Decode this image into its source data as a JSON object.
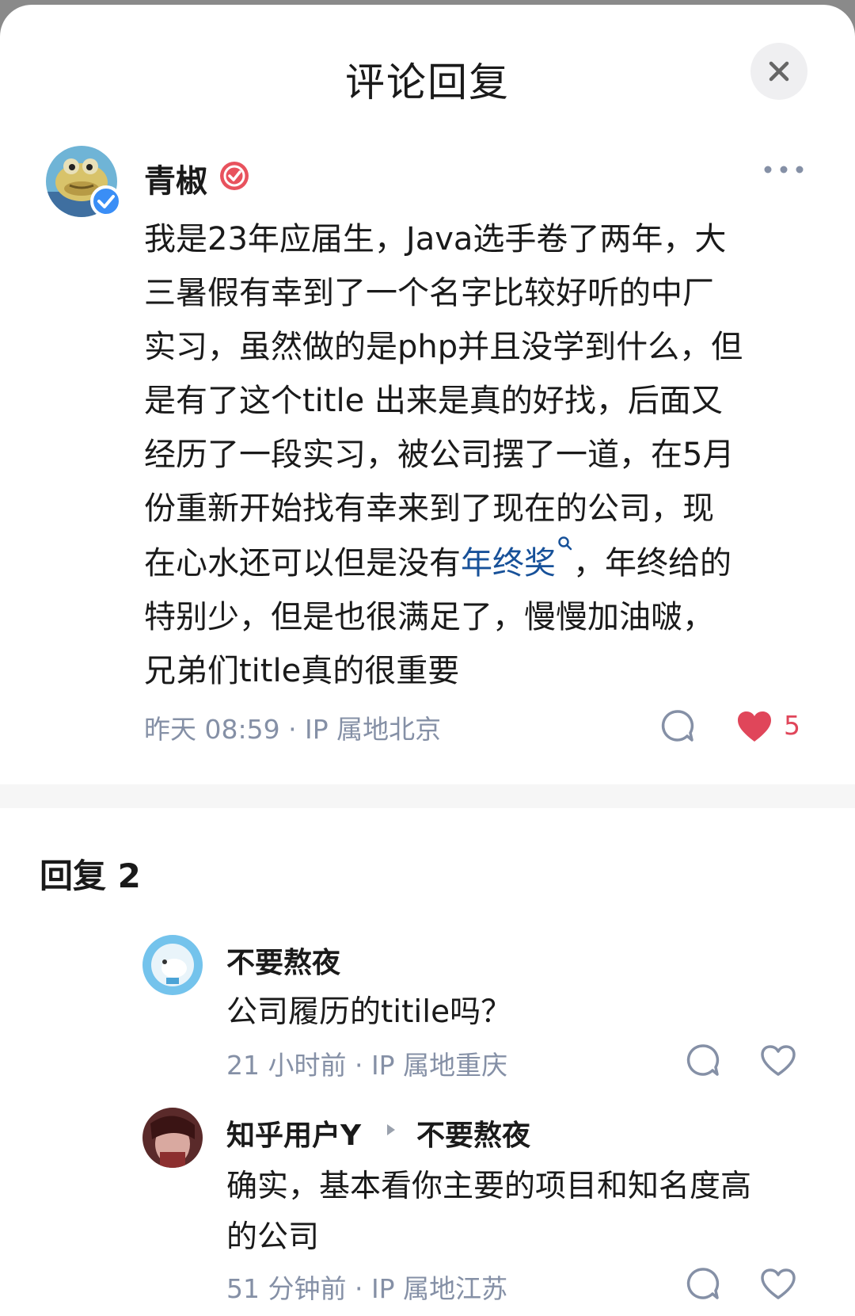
{
  "header": {
    "title": "评论回复"
  },
  "comment": {
    "author": "青椒",
    "text_lines": [
      "我是23年应届生，Java选手卷了两年，大",
      "三暑假有幸到了一个名字比较好听的中厂",
      "实习，虽然做的是php并且没学到什么，但",
      "是有了这个title 出来是真的好找，后面又",
      "经历了一段实习，被公司摆了一道，在5月",
      "份重新开始找有幸来到了现在的公司，现"
    ],
    "line7_before": "在心水还可以但是没有",
    "keyword": "年终奖",
    "line7_after": "，年终给的",
    "text_lines_end": [
      "特别少，但是也很满足了，慢慢加油啵，",
      "兄弟们title真的很重要"
    ],
    "meta": "昨天 08:59 · IP 属地北京",
    "like_count": "5"
  },
  "replies": {
    "title": "回复 2",
    "items": [
      {
        "author": "不要熬夜",
        "text_lines": [
          "公司履历的titile吗？"
        ],
        "meta": "21 小时前 · IP 属地重庆"
      },
      {
        "author": "知乎用户Y",
        "reply_to": "不要熬夜",
        "text_lines": [
          "确实，基本看你主要的项目和知名度高",
          "的公司"
        ],
        "meta": "51 分钟前 · IP 属地江苏"
      }
    ]
  },
  "colors": {
    "link": "#175199",
    "like": "#e0465a",
    "meta": "#8590a6",
    "verified": "#3a8ef6"
  },
  "icons": [
    "close-icon",
    "verified-badge-icon",
    "more-icon",
    "comment-icon",
    "heart-filled-icon",
    "heart-outline-icon",
    "arrow-right-icon",
    "search-icon"
  ]
}
